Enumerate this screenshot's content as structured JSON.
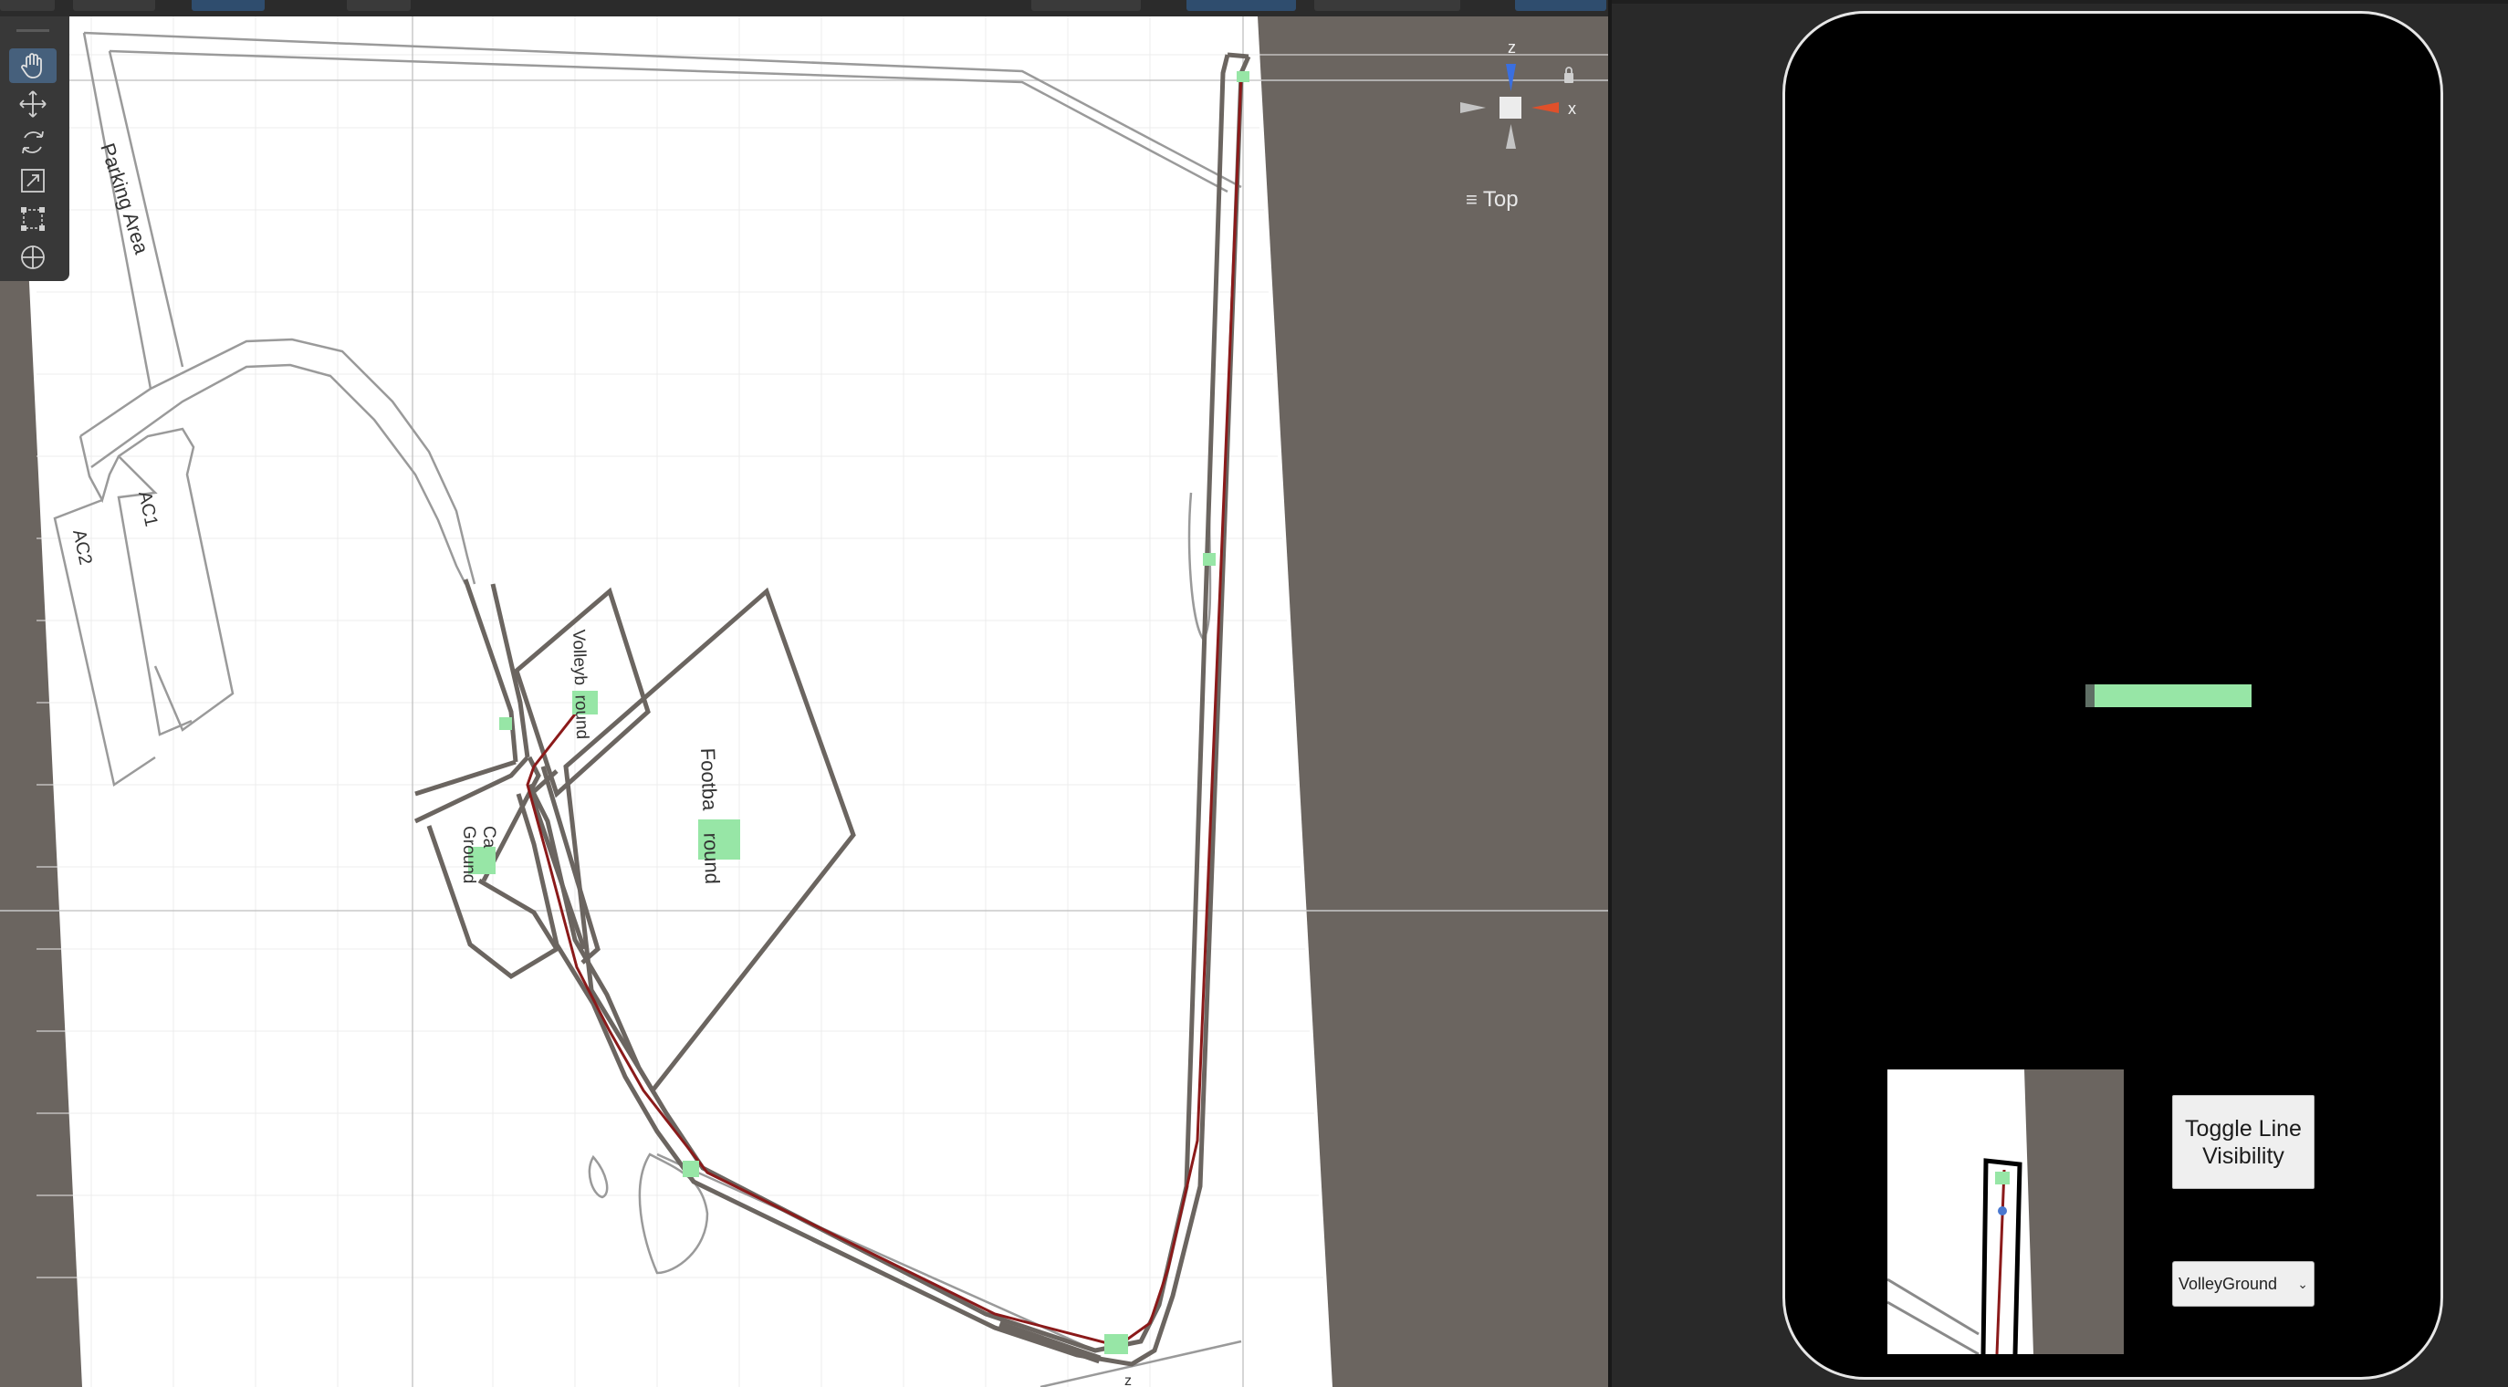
{
  "scene_view": {
    "labels": {
      "parking_area": "Parking Area",
      "ac1": "AC1",
      "ac2": "AC2",
      "volley_ground": "Volleyb  round",
      "football_ground": "Footba    round",
      "cafe_ground_line1": "Ca",
      "cafe_ground_line2": "Ground"
    },
    "tools": [
      "hand-tool",
      "move-tool",
      "rotate-tool",
      "scale-tool",
      "rect-tool",
      "transform-tool"
    ],
    "active_tool": "hand-tool"
  },
  "gizmo": {
    "z_label": "z",
    "x_label": "x",
    "view_label": "Top",
    "colors": {
      "z": "#3a6fe0",
      "x": "#e0502a",
      "neutral": "#bfbfbf"
    }
  },
  "game_view": {
    "toggle_button_label": "Toggle Line Visibility",
    "destination_selected": "VolleyGround"
  },
  "colors": {
    "path_line": "#8b1a1a",
    "marker": "#97e6a6",
    "scene_bg": "#6b6560",
    "phone_bg": "#000000"
  }
}
